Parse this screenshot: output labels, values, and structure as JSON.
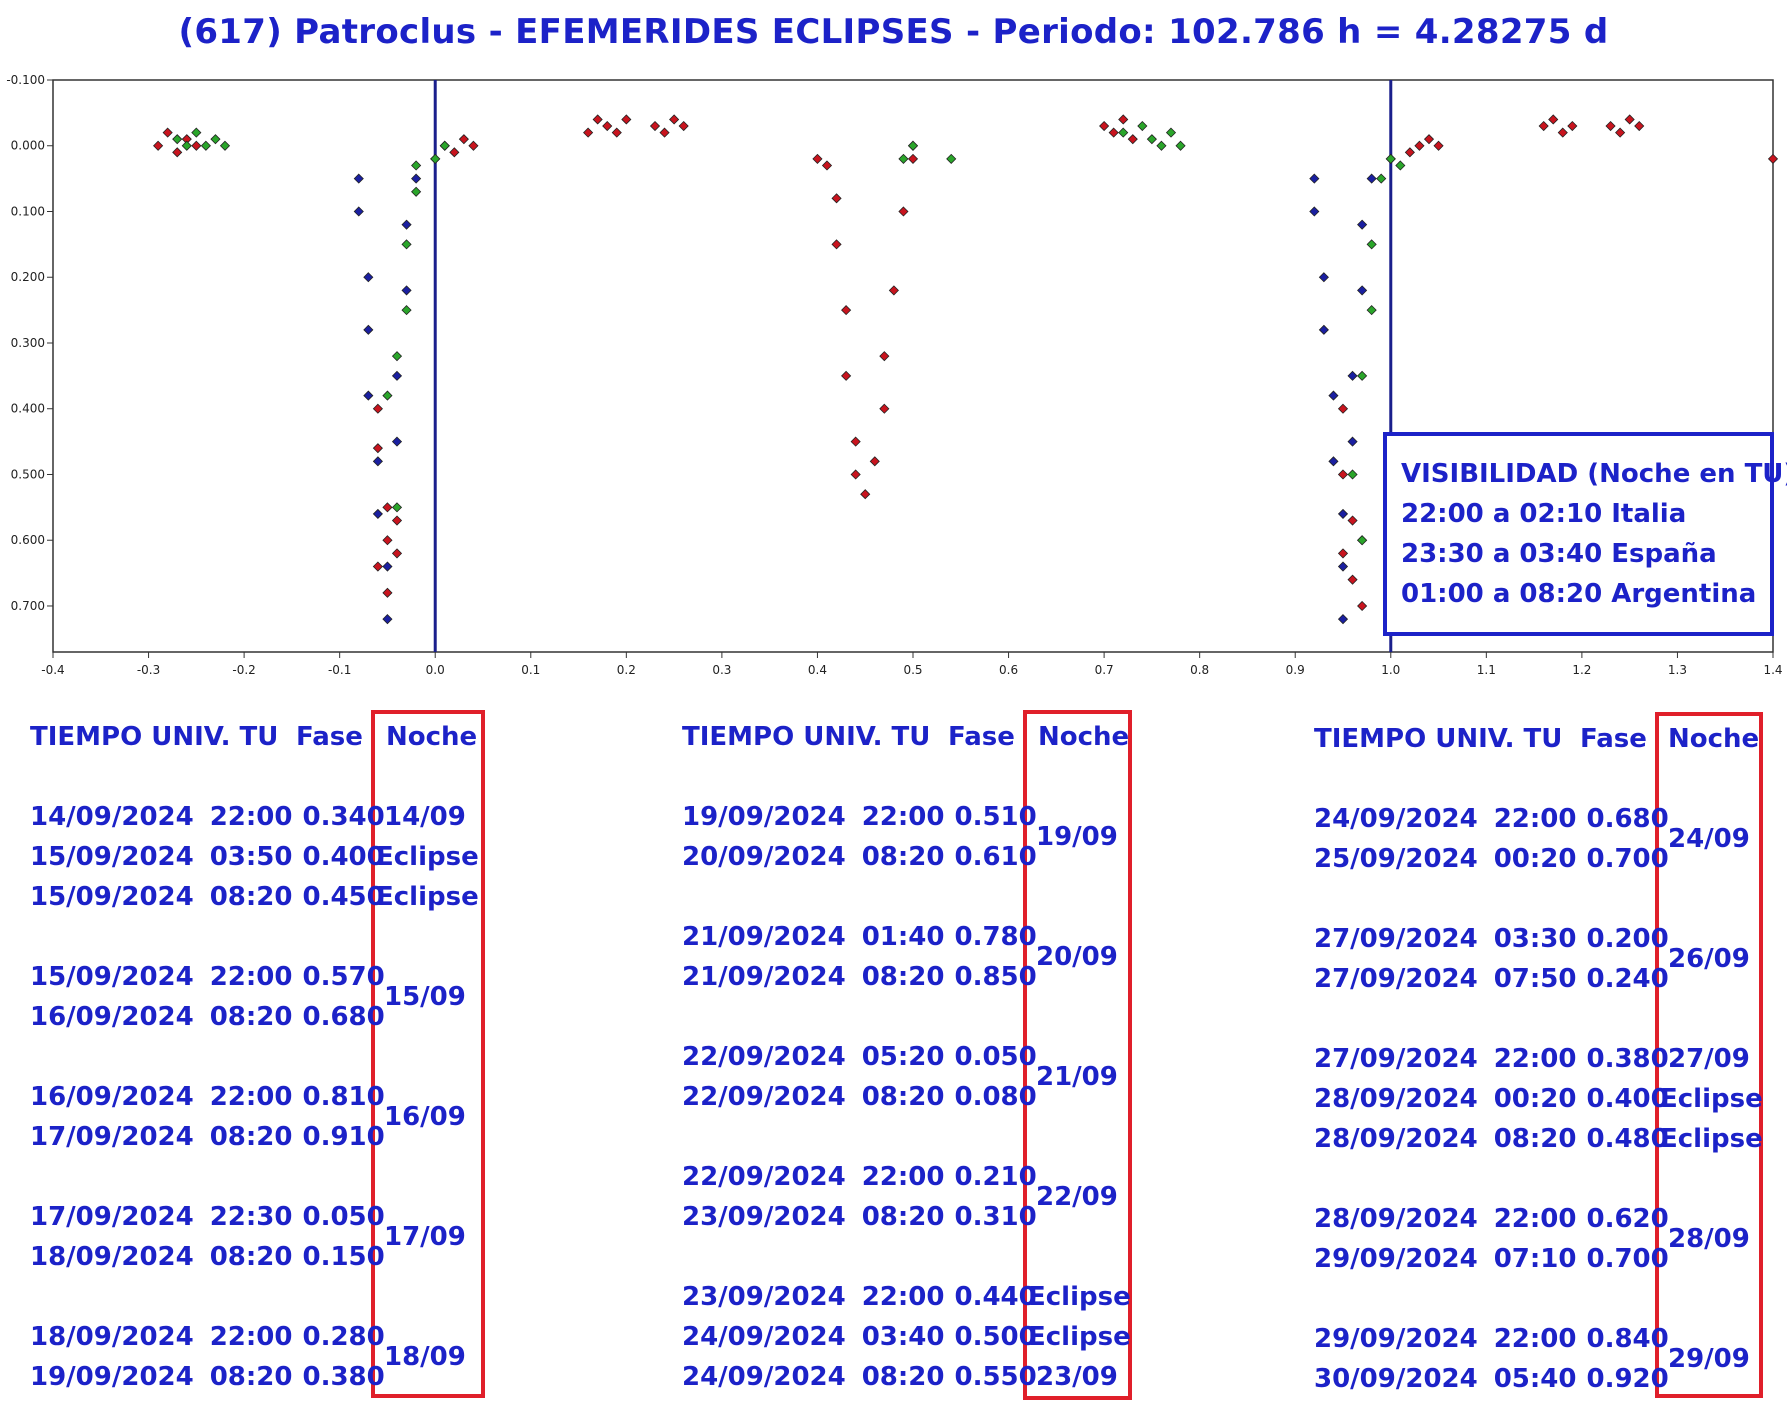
{
  "title": "(617) Patroclus - EFEMERIDES ECLIPSES - Periodo: 102.786 h = 4.28275 d",
  "visibility": {
    "heading": "VISIBILIDAD (Noche en TU)",
    "lines": [
      "22:00 a 02:10 Italia",
      "23:30 a 03:40 España",
      "01:00 a 08:20 Argentina"
    ]
  },
  "colors": {
    "text": "#1c22c8",
    "box": "#e01f2a",
    "series_red": "#c8141e",
    "series_green": "#2aa52a",
    "series_blue": "#1a1fa0"
  },
  "chart_data": {
    "type": "scatter",
    "xlim": [
      -0.4,
      1.4
    ],
    "ylim": [
      -0.1,
      0.77
    ],
    "y_inverted": true,
    "grid": true,
    "x_ticks": [
      "-0.4",
      "-0.3",
      "-0.2",
      "-0.1",
      "0.0",
      "0.1",
      "0.2",
      "0.3",
      "0.4",
      "0.5",
      "0.6",
      "0.7",
      "0.8",
      "0.9",
      "1.0",
      "1.1",
      "1.2",
      "1.3",
      "1.4"
    ],
    "y_ticks": [
      "-0.100",
      "0.000",
      "0.100",
      "0.200",
      "0.300",
      "0.400",
      "0.500",
      "0.600",
      "0.700"
    ],
    "vlines": [
      0.0,
      1.0
    ],
    "series": [
      {
        "color": "#c8141e",
        "points": [
          [
            -0.29,
            0.0
          ],
          [
            -0.28,
            -0.02
          ],
          [
            -0.27,
            0.01
          ],
          [
            -0.26,
            -0.01
          ],
          [
            -0.25,
            0.0
          ],
          [
            -0.06,
            0.4
          ],
          [
            -0.06,
            0.46
          ],
          [
            -0.05,
            0.55
          ],
          [
            -0.05,
            0.6
          ],
          [
            -0.06,
            0.64
          ],
          [
            -0.05,
            0.68
          ],
          [
            -0.04,
            0.62
          ],
          [
            -0.04,
            0.57
          ],
          [
            0.0,
            0.02
          ],
          [
            0.01,
            0.0
          ],
          [
            0.02,
            0.01
          ],
          [
            0.03,
            -0.01
          ],
          [
            0.04,
            0.0
          ],
          [
            0.16,
            -0.02
          ],
          [
            0.17,
            -0.04
          ],
          [
            0.18,
            -0.03
          ],
          [
            0.19,
            -0.02
          ],
          [
            0.2,
            -0.04
          ],
          [
            0.23,
            -0.03
          ],
          [
            0.24,
            -0.02
          ],
          [
            0.25,
            -0.04
          ],
          [
            0.26,
            -0.03
          ],
          [
            0.4,
            0.02
          ],
          [
            0.41,
            0.03
          ],
          [
            0.42,
            0.08
          ],
          [
            0.42,
            0.15
          ],
          [
            0.43,
            0.25
          ],
          [
            0.43,
            0.35
          ],
          [
            0.44,
            0.45
          ],
          [
            0.44,
            0.5
          ],
          [
            0.45,
            0.53
          ],
          [
            0.46,
            0.48
          ],
          [
            0.47,
            0.4
          ],
          [
            0.47,
            0.32
          ],
          [
            0.48,
            0.22
          ],
          [
            0.49,
            0.1
          ],
          [
            0.5,
            0.02
          ],
          [
            0.5,
            0.0
          ],
          [
            0.7,
            -0.03
          ],
          [
            0.71,
            -0.02
          ],
          [
            0.72,
            -0.04
          ],
          [
            0.73,
            -0.01
          ],
          [
            0.95,
            0.4
          ],
          [
            0.95,
            0.5
          ],
          [
            0.96,
            0.57
          ],
          [
            0.95,
            0.62
          ],
          [
            0.96,
            0.66
          ],
          [
            0.97,
            0.7
          ],
          [
            0.97,
            0.6
          ],
          [
            1.0,
            0.02
          ],
          [
            1.02,
            0.01
          ],
          [
            1.03,
            0.0
          ],
          [
            1.04,
            -0.01
          ],
          [
            1.05,
            0.0
          ],
          [
            1.16,
            -0.03
          ],
          [
            1.17,
            -0.04
          ],
          [
            1.18,
            -0.02
          ],
          [
            1.19,
            -0.03
          ],
          [
            1.23,
            -0.03
          ],
          [
            1.24,
            -0.02
          ],
          [
            1.25,
            -0.04
          ],
          [
            1.26,
            -0.03
          ],
          [
            1.4,
            0.02
          ]
        ]
      },
      {
        "color": "#2aa52a",
        "points": [
          [
            -0.27,
            -0.01
          ],
          [
            -0.26,
            0.0
          ],
          [
            -0.25,
            -0.02
          ],
          [
            -0.24,
            0.0
          ],
          [
            -0.23,
            -0.01
          ],
          [
            -0.22,
            0.0
          ],
          [
            -0.05,
            0.38
          ],
          [
            -0.04,
            0.32
          ],
          [
            -0.04,
            0.55
          ],
          [
            -0.03,
            0.25
          ],
          [
            -0.03,
            0.15
          ],
          [
            -0.02,
            0.07
          ],
          [
            -0.02,
            0.03
          ],
          [
            0.0,
            0.02
          ],
          [
            0.01,
            0.0
          ],
          [
            0.49,
            0.02
          ],
          [
            0.5,
            0.0
          ],
          [
            0.54,
            0.02
          ],
          [
            0.72,
            -0.02
          ],
          [
            0.74,
            -0.03
          ],
          [
            0.75,
            -0.01
          ],
          [
            0.76,
            0.0
          ],
          [
            0.77,
            -0.02
          ],
          [
            0.78,
            0.0
          ],
          [
            0.96,
            0.5
          ],
          [
            0.97,
            0.35
          ],
          [
            0.97,
            0.6
          ],
          [
            0.98,
            0.25
          ],
          [
            0.98,
            0.15
          ],
          [
            0.99,
            0.05
          ],
          [
            1.0,
            0.02
          ],
          [
            1.01,
            0.03
          ]
        ]
      },
      {
        "color": "#1a1fa0",
        "points": [
          [
            -0.08,
            0.05
          ],
          [
            -0.08,
            0.1
          ],
          [
            -0.07,
            0.2
          ],
          [
            -0.07,
            0.28
          ],
          [
            -0.07,
            0.38
          ],
          [
            -0.06,
            0.48
          ],
          [
            -0.06,
            0.56
          ],
          [
            -0.05,
            0.64
          ],
          [
            -0.05,
            0.72
          ],
          [
            -0.04,
            0.45
          ],
          [
            -0.04,
            0.35
          ],
          [
            -0.03,
            0.22
          ],
          [
            -0.03,
            0.12
          ],
          [
            -0.02,
            0.05
          ],
          [
            0.92,
            0.05
          ],
          [
            0.92,
            0.1
          ],
          [
            0.93,
            0.2
          ],
          [
            0.93,
            0.28
          ],
          [
            0.94,
            0.38
          ],
          [
            0.94,
            0.48
          ],
          [
            0.95,
            0.56
          ],
          [
            0.95,
            0.64
          ],
          [
            0.95,
            0.72
          ],
          [
            0.96,
            0.45
          ],
          [
            0.96,
            0.35
          ],
          [
            0.97,
            0.22
          ],
          [
            0.97,
            0.12
          ],
          [
            0.98,
            0.05
          ]
        ]
      }
    ]
  },
  "tables": [
    {
      "headers": {
        "time": "TIEMPO UNIV. TU",
        "phase": "Fase",
        "night": "Noche"
      },
      "rows": [
        {
          "date": "14/09/2024",
          "time": "22:00",
          "phase": "0.340"
        },
        {
          "date": "15/09/2024",
          "time": "03:50",
          "phase": "0.400"
        },
        {
          "date": "15/09/2024",
          "time": "08:20",
          "phase": "0.450"
        },
        {
          "date": "15/09/2024",
          "time": "22:00",
          "phase": "0.570"
        },
        {
          "date": "16/09/2024",
          "time": "08:20",
          "phase": "0.680"
        },
        {
          "date": "16/09/2024",
          "time": "22:00",
          "phase": "0.810"
        },
        {
          "date": "17/09/2024",
          "time": "08:20",
          "phase": "0.910"
        },
        {
          "date": "17/09/2024",
          "time": "22:30",
          "phase": "0.050"
        },
        {
          "date": "18/09/2024",
          "time": "08:20",
          "phase": "0.150"
        },
        {
          "date": "18/09/2024",
          "time": "22:00",
          "phase": "0.280"
        },
        {
          "date": "19/09/2024",
          "time": "08:20",
          "phase": "0.380"
        }
      ],
      "night_labels": [
        "14/09",
        "Eclipse",
        "Eclipse",
        "15/09",
        "16/09",
        "17/09",
        "18/09"
      ]
    },
    {
      "headers": {
        "time": "TIEMPO UNIV. TU",
        "phase": "Fase",
        "night": "Noche"
      },
      "rows": [
        {
          "date": "19/09/2024",
          "time": "22:00",
          "phase": "0.510"
        },
        {
          "date": "20/09/2024",
          "time": "08:20",
          "phase": "0.610"
        },
        {
          "date": "21/09/2024",
          "time": "01:40",
          "phase": "0.780"
        },
        {
          "date": "21/09/2024",
          "time": "08:20",
          "phase": "0.850"
        },
        {
          "date": "22/09/2024",
          "time": "05:20",
          "phase": "0.050"
        },
        {
          "date": "22/09/2024",
          "time": "08:20",
          "phase": "0.080"
        },
        {
          "date": "22/09/2024",
          "time": "22:00",
          "phase": "0.210"
        },
        {
          "date": "23/09/2024",
          "time": "08:20",
          "phase": "0.310"
        },
        {
          "date": "23/09/2024",
          "time": "22:00",
          "phase": "0.440"
        },
        {
          "date": "24/09/2024",
          "time": "03:40",
          "phase": "0.500"
        },
        {
          "date": "24/09/2024",
          "time": "08:20",
          "phase": "0.550"
        }
      ],
      "night_labels": [
        "19/09",
        "20/09",
        "21/09",
        "22/09",
        "Eclipse",
        "Eclipse",
        "23/09"
      ]
    },
    {
      "headers": {
        "time": "TIEMPO UNIV. TU",
        "phase": "Fase",
        "night": "Noche"
      },
      "rows": [
        {
          "date": "24/09/2024",
          "time": "22:00",
          "phase": "0.680"
        },
        {
          "date": "25/09/2024",
          "time": "00:20",
          "phase": "0.700"
        },
        {
          "date": "27/09/2024",
          "time": "03:30",
          "phase": "0.200"
        },
        {
          "date": "27/09/2024",
          "time": "07:50",
          "phase": "0.240"
        },
        {
          "date": "27/09/2024",
          "time": "22:00",
          "phase": "0.380"
        },
        {
          "date": "28/09/2024",
          "time": "00:20",
          "phase": "0.400"
        },
        {
          "date": "28/09/2024",
          "time": "08:20",
          "phase": "0.480"
        },
        {
          "date": "28/09/2024",
          "time": "22:00",
          "phase": "0.620"
        },
        {
          "date": "29/09/2024",
          "time": "07:10",
          "phase": "0.700"
        },
        {
          "date": "29/09/2024",
          "time": "22:00",
          "phase": "0.840"
        },
        {
          "date": "30/09/2024",
          "time": "05:40",
          "phase": "0.920"
        }
      ],
      "night_labels": [
        "24/09",
        "26/09",
        "27/09",
        "Eclipse",
        "Eclipse",
        "28/09",
        "29/09"
      ]
    }
  ]
}
